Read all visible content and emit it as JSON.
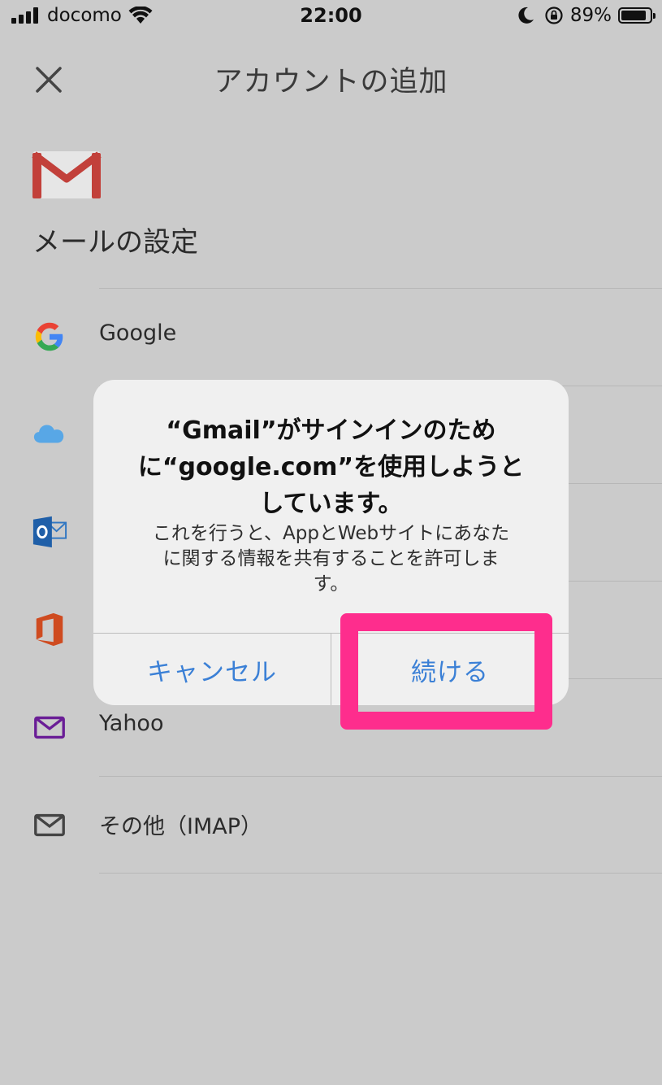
{
  "status_bar": {
    "carrier": "docomo",
    "time": "22:00",
    "battery_percent": "89%",
    "battery_level": 0.89,
    "icons": [
      "signal-icon",
      "wifi-icon",
      "moon-icon",
      "orientation-lock-icon",
      "battery-icon"
    ]
  },
  "header": {
    "title": "アカウントの追加",
    "close_icon": "close-icon"
  },
  "section": {
    "title": "メールの設定",
    "logo_icon": "gmail-logo"
  },
  "providers": [
    {
      "label": "Google",
      "icon": "google-icon"
    },
    {
      "label": "",
      "icon": "icloud-icon"
    },
    {
      "label": "",
      "icon": "outlook-icon"
    },
    {
      "label": "",
      "icon": "office-icon"
    },
    {
      "label": "Yahoo",
      "icon": "yahoo-mail-icon"
    },
    {
      "label": "その他（IMAP）",
      "icon": "mail-icon"
    }
  ],
  "alert": {
    "title_line1": "“Gmail”がサインインのため",
    "title_line2": "に“google.com”を使用しようと",
    "title_line3": "しています。",
    "message_line1": "これを行うと、AppとWebサイトにあなた",
    "message_line2": "に関する情報を共有することを許可しま",
    "message_line3": "す。",
    "cancel_label": "キャンセル",
    "continue_label": "続ける"
  },
  "colors": {
    "background": "#cbcbcb",
    "alert_background": "#f0f0f0",
    "link_blue": "#3b80d6",
    "highlight_pink": "#fe2d8d"
  }
}
